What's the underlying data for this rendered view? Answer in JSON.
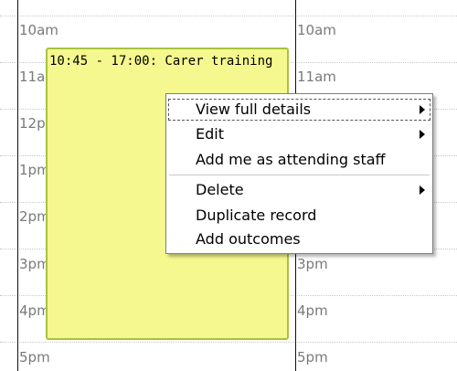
{
  "calendar": {
    "hour_labels_left": [
      "10am",
      "11am",
      "12pm",
      "1pm",
      "2pm",
      "3pm",
      "4pm",
      "5pm"
    ],
    "hour_labels_right": [
      "10am",
      "11am",
      "12pm",
      "1pm",
      "2pm",
      "3pm",
      "4pm",
      "5pm"
    ]
  },
  "event": {
    "title": "10:45 - 17:00: Carer training",
    "color": "#f5f88f",
    "border_color": "#a9c23f"
  },
  "context_menu": {
    "items": [
      {
        "label": "View full details",
        "submenu": true
      },
      {
        "label": "Edit",
        "submenu": true
      },
      {
        "label": "Add me as attending staff",
        "submenu": false
      },
      {
        "label": "Delete",
        "submenu": true
      },
      {
        "label": "Duplicate record",
        "submenu": false
      },
      {
        "label": "Add outcomes",
        "submenu": false
      }
    ]
  }
}
